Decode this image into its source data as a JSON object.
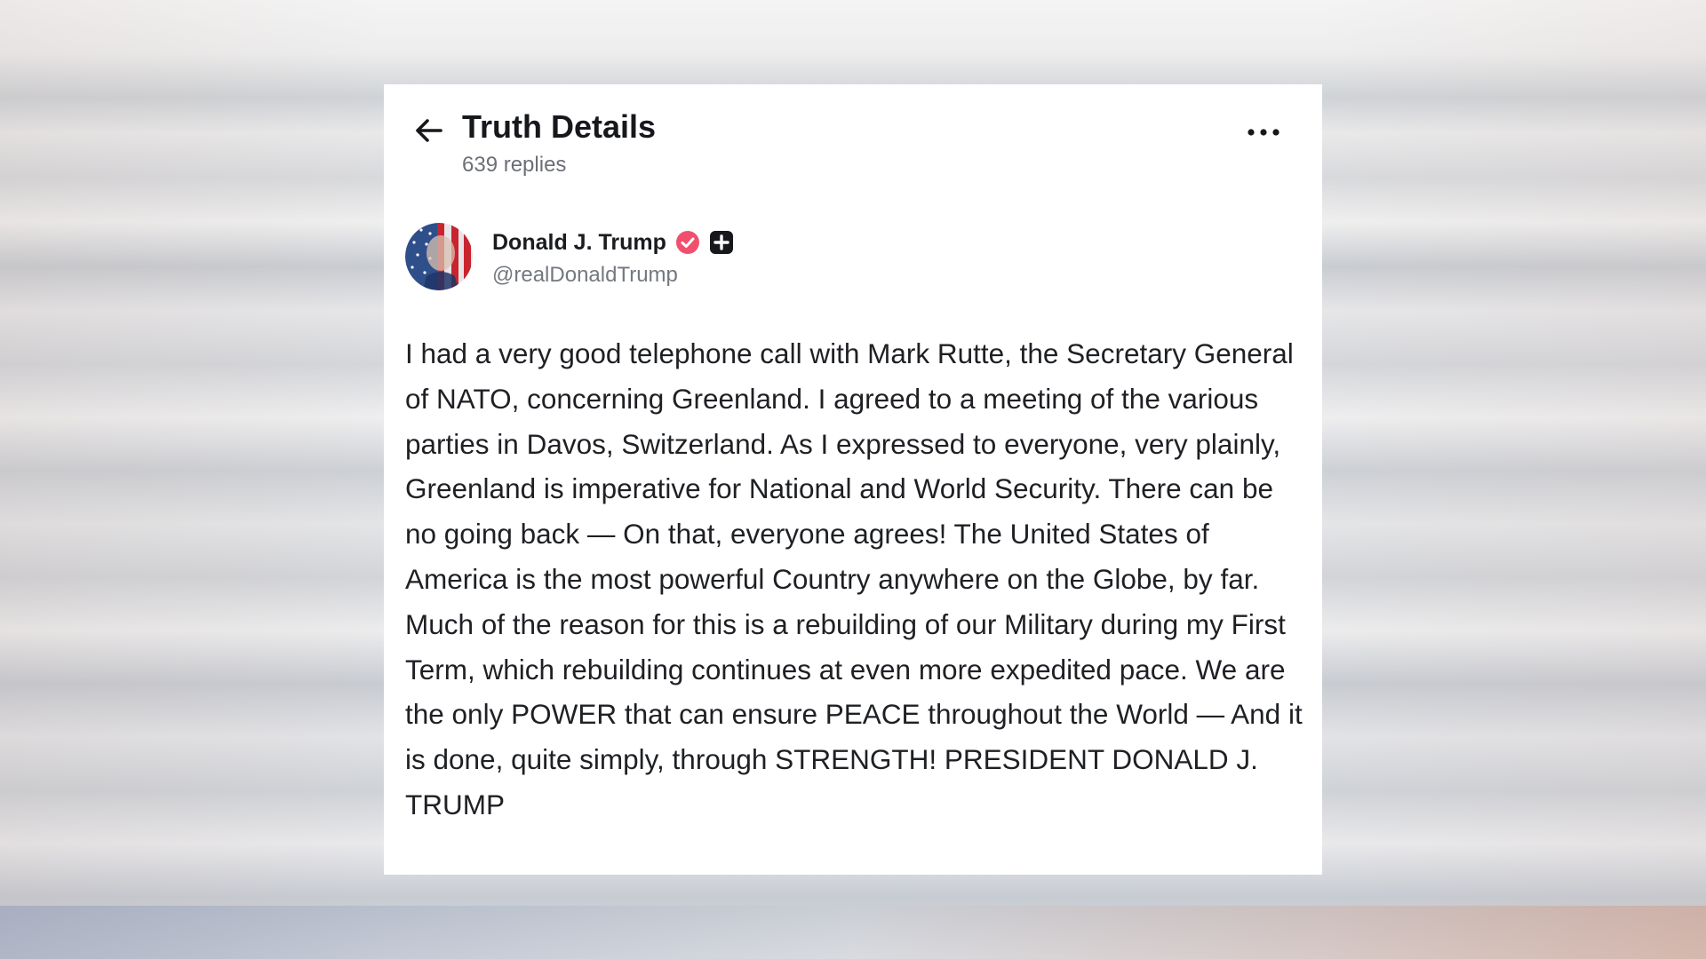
{
  "header": {
    "title": "Truth Details",
    "reply_count": "639 replies",
    "back_icon": "arrow-left-icon",
    "more_icon": "more-horizontal-icon"
  },
  "author": {
    "name": "Donald J. Trump",
    "handle": "@realDonaldTrump",
    "verified_badge_color": "#f0506e",
    "plus_badge_color": "#16181c"
  },
  "post": {
    "text": "I had a very good telephone call with Mark Rutte, the Secretary General of NATO, concerning Greenland. I agreed to a meeting of the various parties in Davos, Switzerland. As I expressed to everyone, very plainly, Greenland is imperative for National and World Security. There can be no going back — On that, everyone agrees! The United States of America is the most powerful Country anywhere on the Globe, by far. Much of the reason for this is a rebuilding of our Military during my First Term, which rebuilding continues at even more expedited pace. We are the only POWER that can ensure PEACE throughout the World — And it is done, quite simply, through STRENGTH! PRESIDENT DONALD J. TRUMP"
  }
}
